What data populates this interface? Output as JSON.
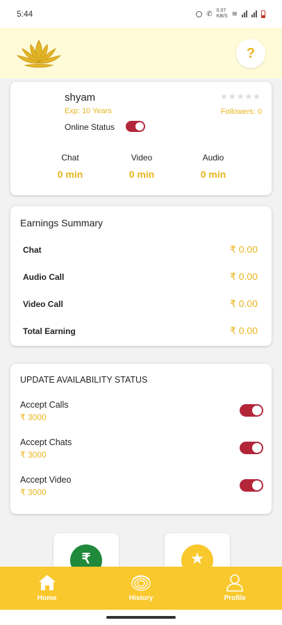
{
  "status_bar": {
    "time": "5:44",
    "network_speed_line1": "0.07",
    "network_speed_line2": "KB/S"
  },
  "header": {
    "logo_icon": "lotus-logo",
    "help_label": "?"
  },
  "profile": {
    "name": "shyam",
    "experience": "Exp: 10 Years",
    "rating": 0,
    "rating_max": 5,
    "followers": "Followers: 0",
    "online_status_label": "Online Status",
    "online_status_on": true,
    "stats": [
      {
        "label": "Chat",
        "value": "0 min"
      },
      {
        "label": "Video",
        "value": "0 min"
      },
      {
        "label": "Audio",
        "value": "0 min"
      }
    ]
  },
  "earnings": {
    "title": "Earnings Summary",
    "rows": [
      {
        "label": "Chat",
        "value": "₹ 0.00"
      },
      {
        "label": "Audio Call",
        "value": "₹ 0.00"
      },
      {
        "label": "Video Call",
        "value": "₹ 0.00"
      },
      {
        "label": "Total Earning",
        "value": "₹ 0.00"
      }
    ]
  },
  "availability": {
    "title": "UPDATE AVAILABILITY STATUS",
    "rows": [
      {
        "label": "Accept Calls",
        "price": "₹ 3000",
        "on": true
      },
      {
        "label": "Accept Chats",
        "price": "₹ 3000",
        "on": true
      },
      {
        "label": "Accept Video",
        "price": "₹ 3000",
        "on": true
      }
    ]
  },
  "quick_actions": {
    "wallet_icon": "rupee-icon",
    "wallet_glyph": "₹",
    "wallet_color": "#1f8a3b",
    "rating_icon": "star-icon",
    "rating_glyph": "★",
    "rating_color": "#f8c82d"
  },
  "bottom_nav": {
    "items": [
      {
        "label": "Home",
        "icon": "home-icon"
      },
      {
        "label": "History",
        "icon": "history-icon"
      },
      {
        "label": "Profile",
        "icon": "profile-icon"
      }
    ]
  },
  "colors": {
    "accent": "#e8b51e",
    "nav_bg": "#f8c82d",
    "toggle_on": "#b3263a",
    "header_bg": "#fffbd8"
  }
}
